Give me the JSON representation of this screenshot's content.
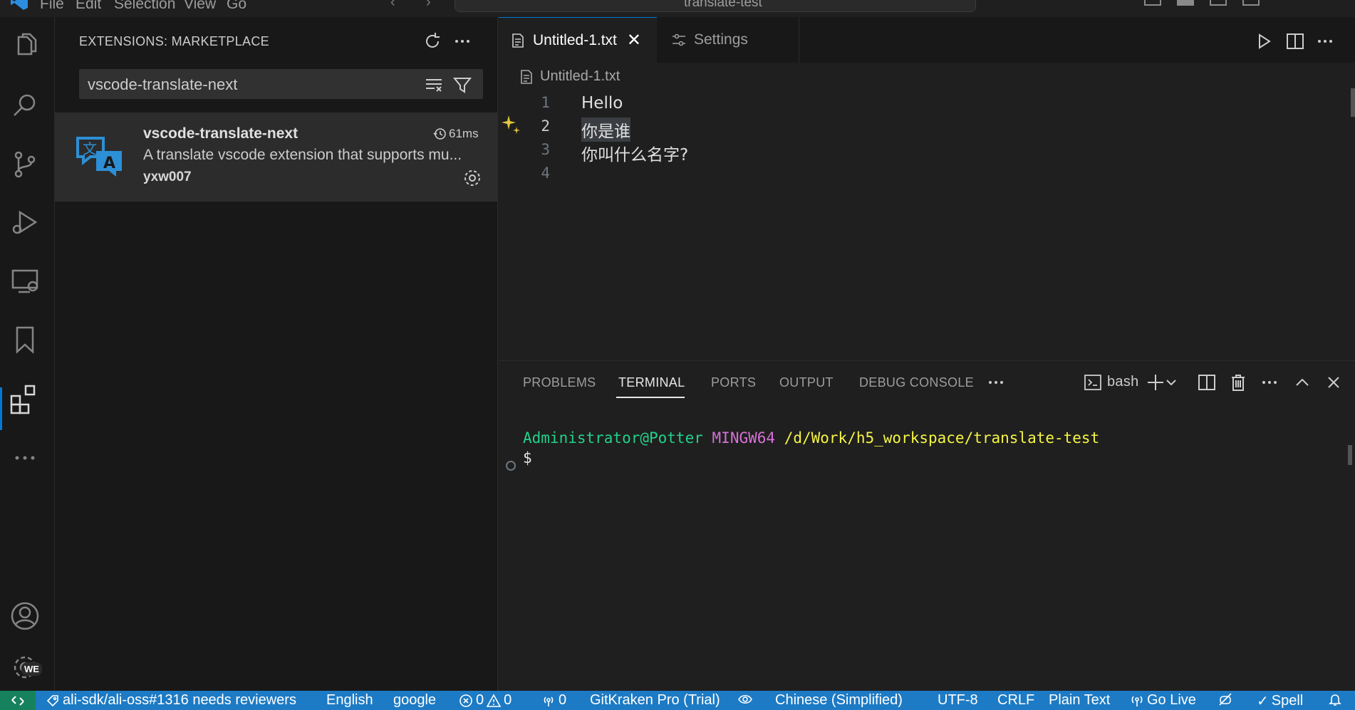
{
  "titlebar": {
    "menu": [
      "File",
      "Edit",
      "Selection",
      "View",
      "Go"
    ],
    "search_text": "translate-test"
  },
  "sidebar": {
    "title": "EXTENSIONS: MARKETPLACE",
    "search_value": "vscode-translate-next",
    "extension": {
      "name": "vscode-translate-next",
      "description": "A translate vscode extension that supports mu...",
      "author": "yxw007",
      "time": "61ms"
    }
  },
  "editor": {
    "tabs": [
      {
        "label": "Untitled-1.txt",
        "active": true
      },
      {
        "label": "Settings",
        "active": false
      }
    ],
    "breadcrumb": "Untitled-1.txt",
    "lines": [
      {
        "num": "1",
        "text": "Hello"
      },
      {
        "num": "2",
        "text": "你是谁"
      },
      {
        "num": "3",
        "text": "你叫什么名字?"
      },
      {
        "num": "4",
        "text": ""
      }
    ]
  },
  "panel": {
    "tabs": [
      "PROBLEMS",
      "TERMINAL",
      "PORTS",
      "OUTPUT",
      "DEBUG CONSOLE"
    ],
    "active_tab": "TERMINAL",
    "shell": "bash",
    "terminal": {
      "user": "Administrator@Potter",
      "host": "MINGW64",
      "path": "/d/Work/h5_workspace/translate-test",
      "prompt": "$"
    }
  },
  "activitybar": {
    "badge": "WE"
  },
  "statusbar": {
    "pr": "ali-sdk/ali-oss#1316 needs reviewers",
    "language_name": "English",
    "engine": "google",
    "errors": "0",
    "warnings": "0",
    "ports": "0",
    "gitkraken": "GitKraken Pro (Trial)",
    "target_language": "Chinese (Simplified)",
    "encoding": "UTF-8",
    "eol": "CRLF",
    "mode": "Plain Text",
    "golive": "Go Live",
    "spell": "Spell"
  },
  "colors": {
    "accent": "#0078d4",
    "statusbar": "#1d7ac4",
    "remote": "#16825d"
  }
}
